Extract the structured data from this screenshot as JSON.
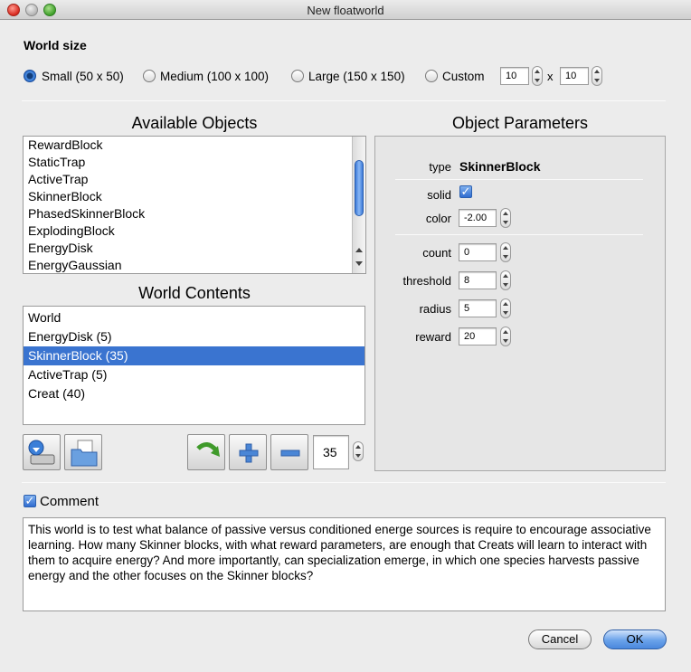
{
  "window": {
    "title": "New floatworld"
  },
  "world_size": {
    "heading": "World size",
    "options": [
      {
        "label": "Small (50 x 50)",
        "selected": true
      },
      {
        "label": "Medium (100 x 100)",
        "selected": false
      },
      {
        "label": "Large (150 x 150)",
        "selected": false
      },
      {
        "label": "Custom",
        "selected": false
      }
    ],
    "custom_width": "10",
    "times": "x",
    "custom_height": "10"
  },
  "available_objects": {
    "title": "Available Objects",
    "items": [
      "RewardBlock",
      "StaticTrap",
      "ActiveTrap",
      "SkinnerBlock",
      "PhasedSkinnerBlock",
      "ExplodingBlock",
      "EnergyDisk",
      "EnergyGaussian"
    ]
  },
  "world_contents": {
    "title": "World Contents",
    "items": [
      {
        "label": "World",
        "selected": false
      },
      {
        "label": "EnergyDisk (5)",
        "selected": false
      },
      {
        "label": "SkinnerBlock (35)",
        "selected": true
      },
      {
        "label": "ActiveTrap (5)",
        "selected": false
      },
      {
        "label": "Creat (40)",
        "selected": false
      }
    ],
    "count_value": "35"
  },
  "object_parameters": {
    "title": "Object Parameters",
    "type_label": "type",
    "type_value": "SkinnerBlock",
    "solid_label": "solid",
    "solid_checked": true,
    "color_label": "color",
    "color_value": "-2.00",
    "count_label": "count",
    "count_value": "0",
    "threshold_label": "threshold",
    "threshold_value": "8",
    "radius_label": "radius",
    "radius_value": "5",
    "reward_label": "reward",
    "reward_value": "20"
  },
  "comment": {
    "label": "Comment",
    "checked": true,
    "text": "This world is to test what balance of passive versus conditioned energe sources is require to encourage associative learning. How many Skinner blocks, with what reward parameters, are enough that Creats will learn to interact with them to acquire energy? And more importantly, can specialization emerge, in which one species harvests passive energy and the other focuses on the Skinner blocks?"
  },
  "buttons": {
    "cancel": "Cancel",
    "ok": "OK"
  },
  "colors": {
    "selection": "#3a74d0",
    "window_bg": "#ececec"
  }
}
